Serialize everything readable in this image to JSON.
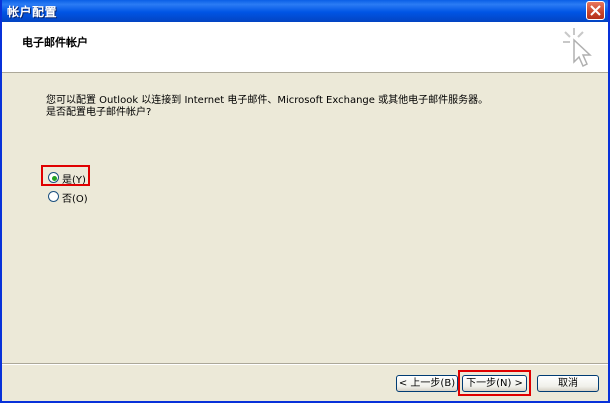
{
  "window": {
    "title": "帐户配置"
  },
  "header": {
    "title": "电子邮件帐户",
    "icon": "wizard-cursor-icon"
  },
  "content": {
    "description_line1": "您可以配置 Outlook 以连接到 Internet 电子邮件、Microsoft Exchange 或其他电子邮件服务器。",
    "description_line2": "是否配置电子邮件帐户?",
    "options": [
      {
        "label": "是(Y)",
        "selected": true
      },
      {
        "label": "否(O)",
        "selected": false
      }
    ]
  },
  "buttons": {
    "back": "< 上一步(B)",
    "next": "下一步(N) >",
    "cancel": "取消"
  },
  "colors": {
    "titlebar": "#0055e5",
    "dialog_bg": "#ece9d8",
    "highlight": "#e00000",
    "radio_dot": "#21a121"
  }
}
